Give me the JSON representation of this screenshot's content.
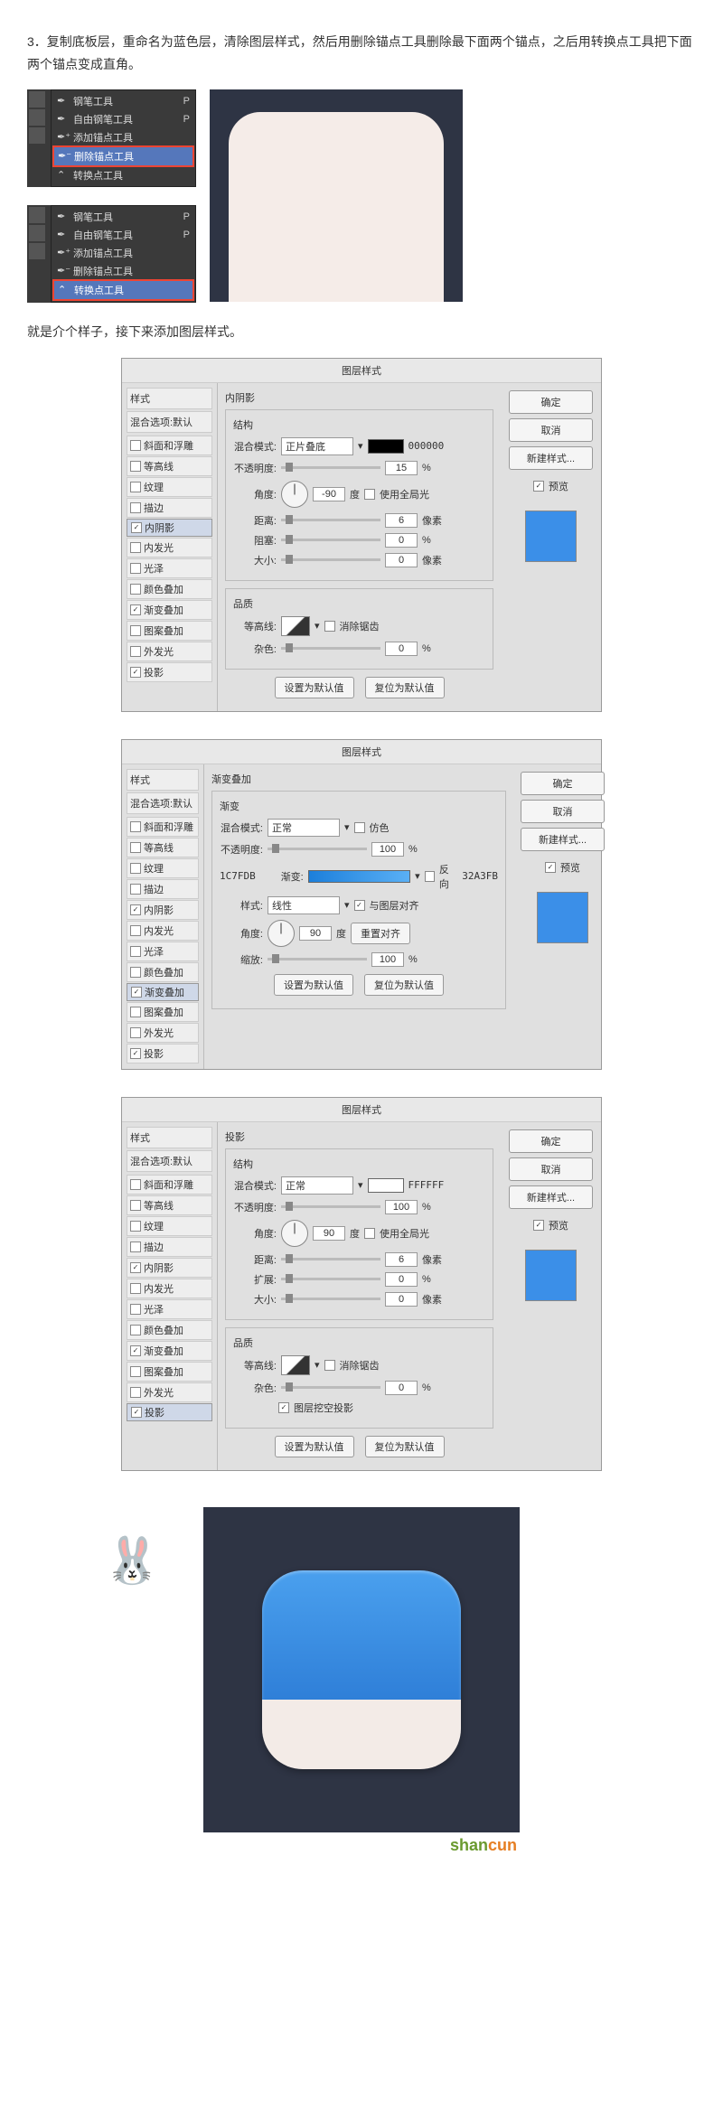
{
  "intro": {
    "step": "3．复制底板层，重命名为蓝色层，清除图层样式，然后用删除锚点工具删除最下面两个锚点，之后用转换点工具把下面两个锚点变成直角。",
    "bridge": "就是介个样子，接下来添加图层样式。"
  },
  "tools": {
    "pen": "钢笔工具",
    "freeform": "自由钢笔工具",
    "addAnchor": "添加锚点工具",
    "deleteAnchor": "删除锚点工具",
    "convert": "转换点工具",
    "keyP": "P"
  },
  "dlg": {
    "title": "图层样式",
    "styleHdr": "样式",
    "blendDefault": "混合选项:默认",
    "ok": "确定",
    "cancel": "取消",
    "newStyle": "新建样式...",
    "preview": "预览",
    "items": {
      "bevel": "斜面和浮雕",
      "contourSub": "等高线",
      "textureSub": "纹理",
      "stroke": "描边",
      "innerShadow": "内阴影",
      "innerGlow": "内发光",
      "satin": "光泽",
      "colorOverlay": "颜色叠加",
      "gradOverlay": "渐变叠加",
      "patternOverlay": "图案叠加",
      "outerGlow": "外发光",
      "dropShadow": "投影"
    }
  },
  "labels": {
    "structure": "结构",
    "blendMode": "混合模式:",
    "opacity": "不透明度:",
    "angle": "角度:",
    "deg": "度",
    "useGlobal": "使用全局光",
    "distance": "距离:",
    "choke": "阻塞:",
    "spread": "扩展:",
    "size": "大小:",
    "px": "像素",
    "pct": "%",
    "quality": "品质",
    "contour": "等高线:",
    "antiAlias": "消除锯齿",
    "noise": "杂色:",
    "setDefault": "设置为默认值",
    "resetDefault": "复位为默认值",
    "gradient": "渐变:",
    "reverse": "反向",
    "style": "样式:",
    "alignLayer": "与图层对齐",
    "resetAlign": "重置对齐",
    "scale": "缩放:",
    "knockout": "图层挖空投影",
    "dither": "仿色",
    "gradSection": "渐变"
  },
  "panel1": {
    "title": "内阴影",
    "mode": "正片叠底",
    "color": "000000",
    "opacity": "15",
    "angle": "-90",
    "distance": "6",
    "choke": "0",
    "size": "0",
    "noise": "0"
  },
  "panel2": {
    "title": "渐变叠加",
    "mode": "正常",
    "opacity": "100",
    "colorA": "1C7FDB",
    "colorB": "32A3FB",
    "style": "线性",
    "angle": "90",
    "scale": "100"
  },
  "panel3": {
    "title": "投影",
    "mode": "正常",
    "color": "FFFFFF",
    "opacity": "100",
    "angle": "90",
    "distance": "6",
    "spread": "0",
    "size": "0",
    "noise": "0"
  },
  "watermark": {
    "a": "shan",
    "b": "cun"
  }
}
